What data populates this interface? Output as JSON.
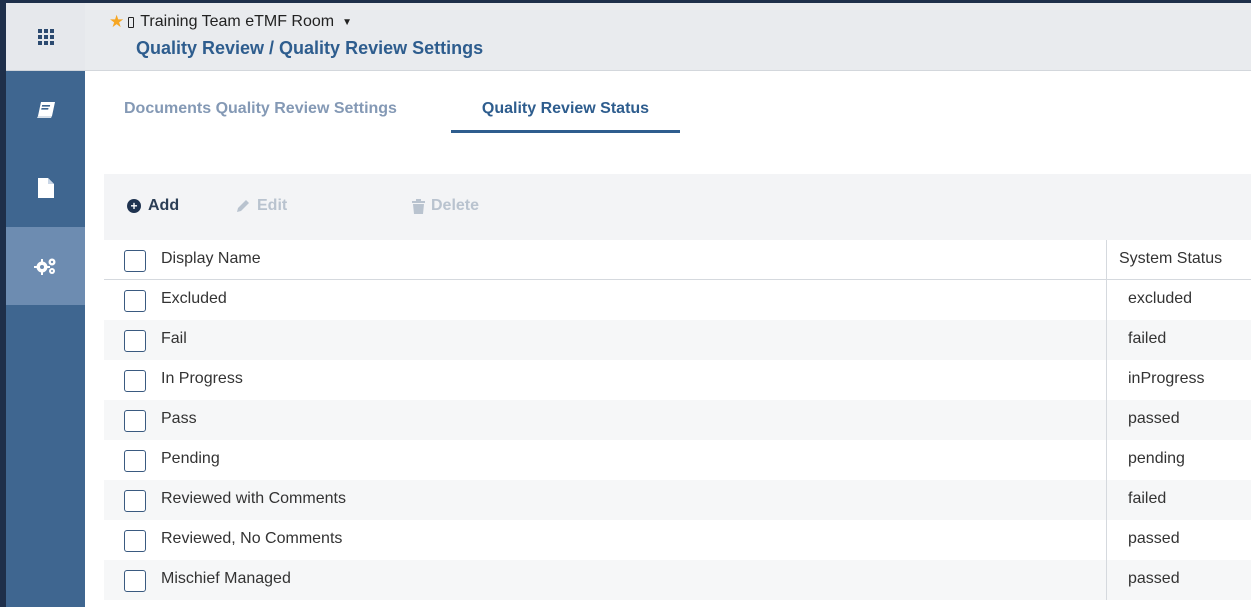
{
  "header": {
    "room_name": "Training Team eTMF Room",
    "breadcrumb": "Quality Review / Quality Review Settings"
  },
  "tabs": [
    {
      "label": "Documents Quality Review Settings",
      "active": false
    },
    {
      "label": "Quality Review Status",
      "active": true
    }
  ],
  "toolbar": {
    "add_label": "Add",
    "edit_label": "Edit",
    "delete_label": "Delete"
  },
  "table": {
    "columns": [
      "Display Name",
      "System Status"
    ],
    "rows": [
      {
        "display_name": "Excluded",
        "system_status": "excluded"
      },
      {
        "display_name": "Fail",
        "system_status": "failed"
      },
      {
        "display_name": "In Progress",
        "system_status": "inProgress"
      },
      {
        "display_name": "Pass",
        "system_status": "passed"
      },
      {
        "display_name": "Pending",
        "system_status": "pending"
      },
      {
        "display_name": "Reviewed with Comments",
        "system_status": "failed"
      },
      {
        "display_name": "Reviewed, No Comments",
        "system_status": "passed"
      },
      {
        "display_name": "Mischief Managed",
        "system_status": "passed"
      }
    ]
  },
  "sidebar": {
    "items": [
      {
        "icon": "apps-grid-icon"
      },
      {
        "icon": "book-icon"
      },
      {
        "icon": "document-icon"
      },
      {
        "icon": "settings-gears-icon",
        "active": true
      }
    ]
  },
  "colors": {
    "sidebar": "#3f6690",
    "sidebar_active": "#6d8cb1",
    "accent": "#2e5d8e",
    "disabled": "#b9c3cf",
    "star": "#f6a623"
  }
}
